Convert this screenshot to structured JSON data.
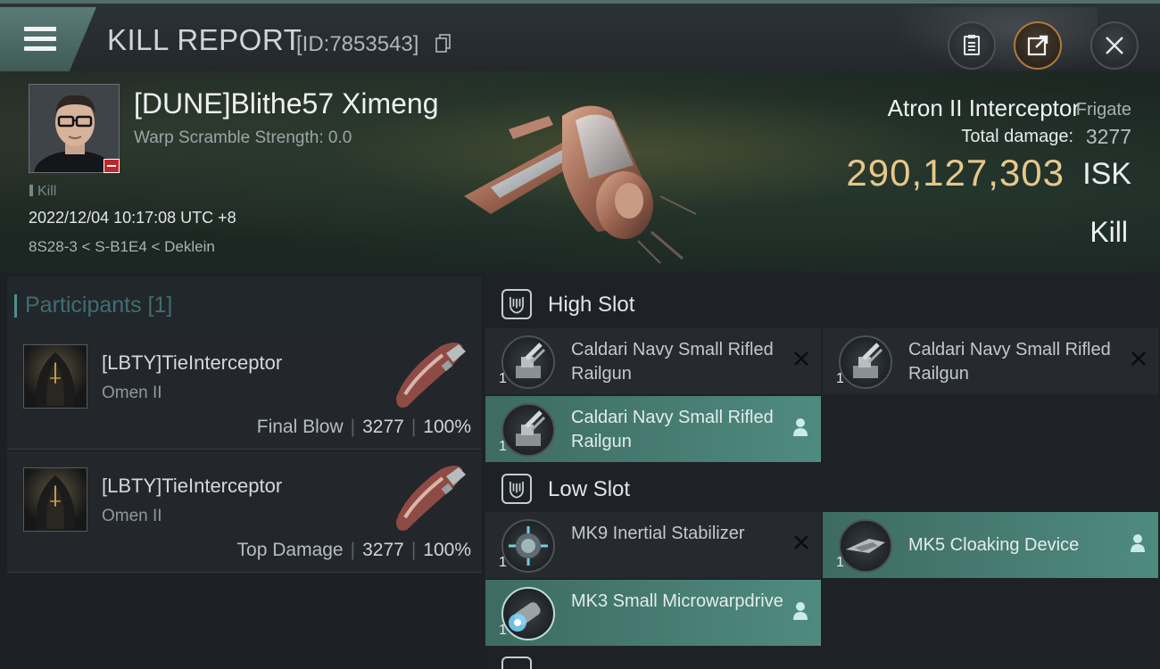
{
  "header": {
    "title": "KILL REPORT",
    "report_id": "[ID:7853543]"
  },
  "victim": {
    "name": "[DUNE]Blithe57 Ximeng",
    "warp_scramble": "Warp Scramble Strength: 0.0",
    "kill_tag": "Kill",
    "timestamp": "2022/12/04 10:17:08 UTC +8",
    "location": "8S28-3 < S-B1E4 < Deklein",
    "ship_name": "Atron II Interceptor",
    "ship_class": "Frigate",
    "total_damage_label": "Total damage:",
    "total_damage": "3277",
    "isk_value": "290,127,303",
    "isk_unit": "ISK",
    "result": "Kill"
  },
  "participants": {
    "title": "Participants [1]",
    "rows": [
      {
        "name": "[LBTY]TieInterceptor",
        "ship": "Omen II",
        "role": "Final Blow",
        "damage": "3277",
        "percent": "100%"
      },
      {
        "name": "[LBTY]TieInterceptor",
        "ship": "Omen II",
        "role": "Top Damage",
        "damage": "3277",
        "percent": "100%"
      }
    ]
  },
  "fitting": {
    "high_slot": {
      "label": "High Slot",
      "modules": [
        {
          "name": "Caldari Navy Small Rifled Railgun",
          "qty": "1",
          "state": "destroyed"
        },
        {
          "name": "Caldari Navy Small Rifled Railgun",
          "qty": "1",
          "state": "destroyed"
        },
        {
          "name": "Caldari Navy Small Rifled Railgun",
          "qty": "1",
          "state": "dropped"
        }
      ]
    },
    "low_slot": {
      "label": "Low Slot",
      "modules": [
        {
          "name": "MK9 Inertial Stabilizer",
          "qty": "1",
          "state": "destroyed"
        },
        {
          "name": "MK5 Cloaking Device",
          "qty": "1",
          "state": "dropped"
        },
        {
          "name": "MK3 Small Microwarpdrive",
          "qty": "1",
          "state": "dropped"
        }
      ]
    }
  },
  "colors": {
    "accent_teal": "#4f8a80",
    "isk_gold": "#e8c78a",
    "badge_red": "#c0272d"
  }
}
